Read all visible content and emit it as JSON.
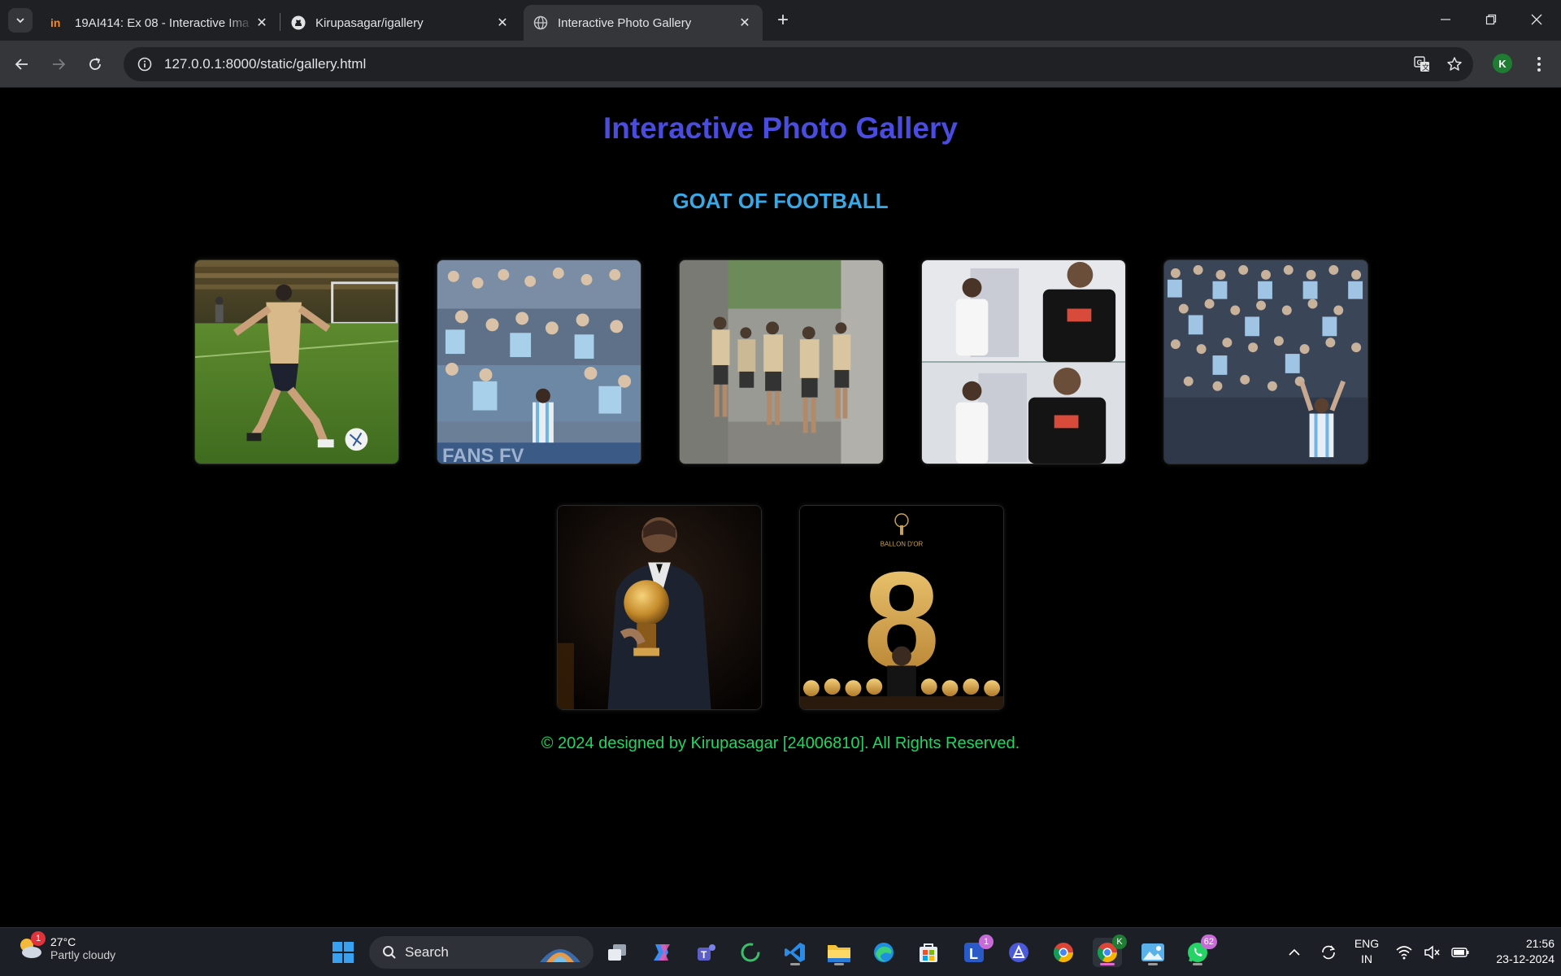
{
  "browser": {
    "tabs": [
      {
        "title": "19AI414: Ex 08 - Interactive Ima",
        "favicon": "in-logo-icon",
        "active": false
      },
      {
        "title": "Kirupasagar/igallery",
        "favicon": "github-icon",
        "active": false
      },
      {
        "title": "Interactive Photo Gallery",
        "favicon": "globe-icon",
        "active": true
      }
    ],
    "url": "127.0.0.1:8000/static/gallery.html",
    "profile_initial": "K"
  },
  "page": {
    "title": "Interactive Photo Gallery",
    "subtitle": "GOAT OF FOOTBALL",
    "photos": [
      {
        "subject": "player-kicking-ball-on-pitch"
      },
      {
        "subject": "crowd-celebrating-in-stands"
      },
      {
        "subject": "team-walking-in-tunnel"
      },
      {
        "subject": "player-with-child-collage"
      },
      {
        "subject": "fans-celebration-crowd"
      },
      {
        "subject": "player-holding-ballon-dor-trophy"
      },
      {
        "subject": "ballon-dor-8-poster",
        "poster_text": "BALLON D'OR",
        "poster_number": "8"
      }
    ],
    "footer": "© 2024 designed by Kirupasagar [24006810]. All Rights Reserved.",
    "colors": {
      "title": "#4a4ce0",
      "subtitle": "#38a8e6",
      "footer": "#1ed760",
      "background": "#000000"
    }
  },
  "taskbar": {
    "weather": {
      "temp": "27°C",
      "condition": "Partly cloudy",
      "badge": "1"
    },
    "search_label": "Search",
    "apps": [
      {
        "name": "start-icon"
      },
      {
        "name": "task-view-icon"
      },
      {
        "name": "copilot-icon"
      },
      {
        "name": "teams-icon"
      },
      {
        "name": "refresh-circle-app-icon"
      },
      {
        "name": "vscode-icon"
      },
      {
        "name": "file-explorer-icon"
      },
      {
        "name": "edge-icon"
      },
      {
        "name": "store-icon"
      },
      {
        "name": "l-app-icon",
        "badge": "1"
      },
      {
        "name": "triangle-app-icon"
      },
      {
        "name": "chrome-icon"
      },
      {
        "name": "chrome-profile-icon",
        "badge": "K"
      },
      {
        "name": "photos-icon"
      },
      {
        "name": "whatsapp-icon",
        "badge": "62"
      }
    ],
    "tray": {
      "lang_line1": "ENG",
      "lang_line2": "IN",
      "time": "21:56",
      "date": "23-12-2024"
    }
  }
}
